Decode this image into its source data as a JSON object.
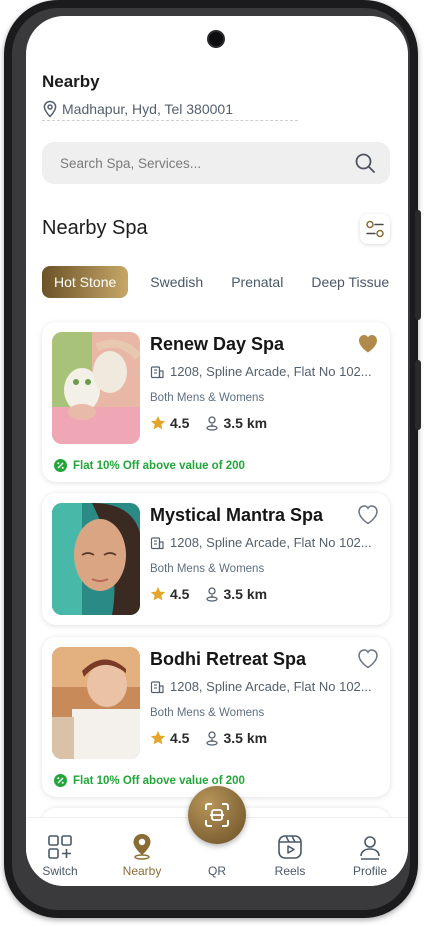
{
  "header": {
    "title": "Nearby",
    "location": "Madhapur, Hyd, Tel 380001"
  },
  "search": {
    "placeholder": "Search Spa, Services..."
  },
  "section": {
    "title": "Nearby Spa"
  },
  "categories": [
    "Hot Stone",
    "Swedish",
    "Prenatal",
    "Deep Tissue"
  ],
  "spas": [
    {
      "name": "Renew Day Spa",
      "address": "1208, Spline Arcade, Flat No 102...",
      "gender": "Both Mens & Womens",
      "rating": "4.5",
      "distance": "3.5 km",
      "favorited": true,
      "offer": "Flat 10% Off above value of 200"
    },
    {
      "name": "Mystical Mantra Spa",
      "address": "1208, Spline Arcade, Flat No 102...",
      "gender": "Both Mens & Womens",
      "rating": "4.5",
      "distance": "3.5 km",
      "favorited": false,
      "offer": ""
    },
    {
      "name": "Bodhi Retreat Spa",
      "address": "1208, Spline Arcade, Flat No 102...",
      "gender": "Both Mens & Womens",
      "rating": "4.5",
      "distance": "3.5 km",
      "favorited": false,
      "offer": "Flat 10% Off above value of 200"
    }
  ],
  "nav": {
    "items": [
      {
        "label": "Switch",
        "icon": "switch-icon"
      },
      {
        "label": "Nearby",
        "icon": "location-pin-icon"
      },
      {
        "label": "QR",
        "icon": "qr-scan-icon"
      },
      {
        "label": "Reels",
        "icon": "reels-icon"
      },
      {
        "label": "Profile",
        "icon": "profile-icon"
      }
    ],
    "active": "Nearby"
  },
  "colors": {
    "accent": "#8a6d35",
    "offer": "#22a63a",
    "search_bg": "#efefef"
  }
}
